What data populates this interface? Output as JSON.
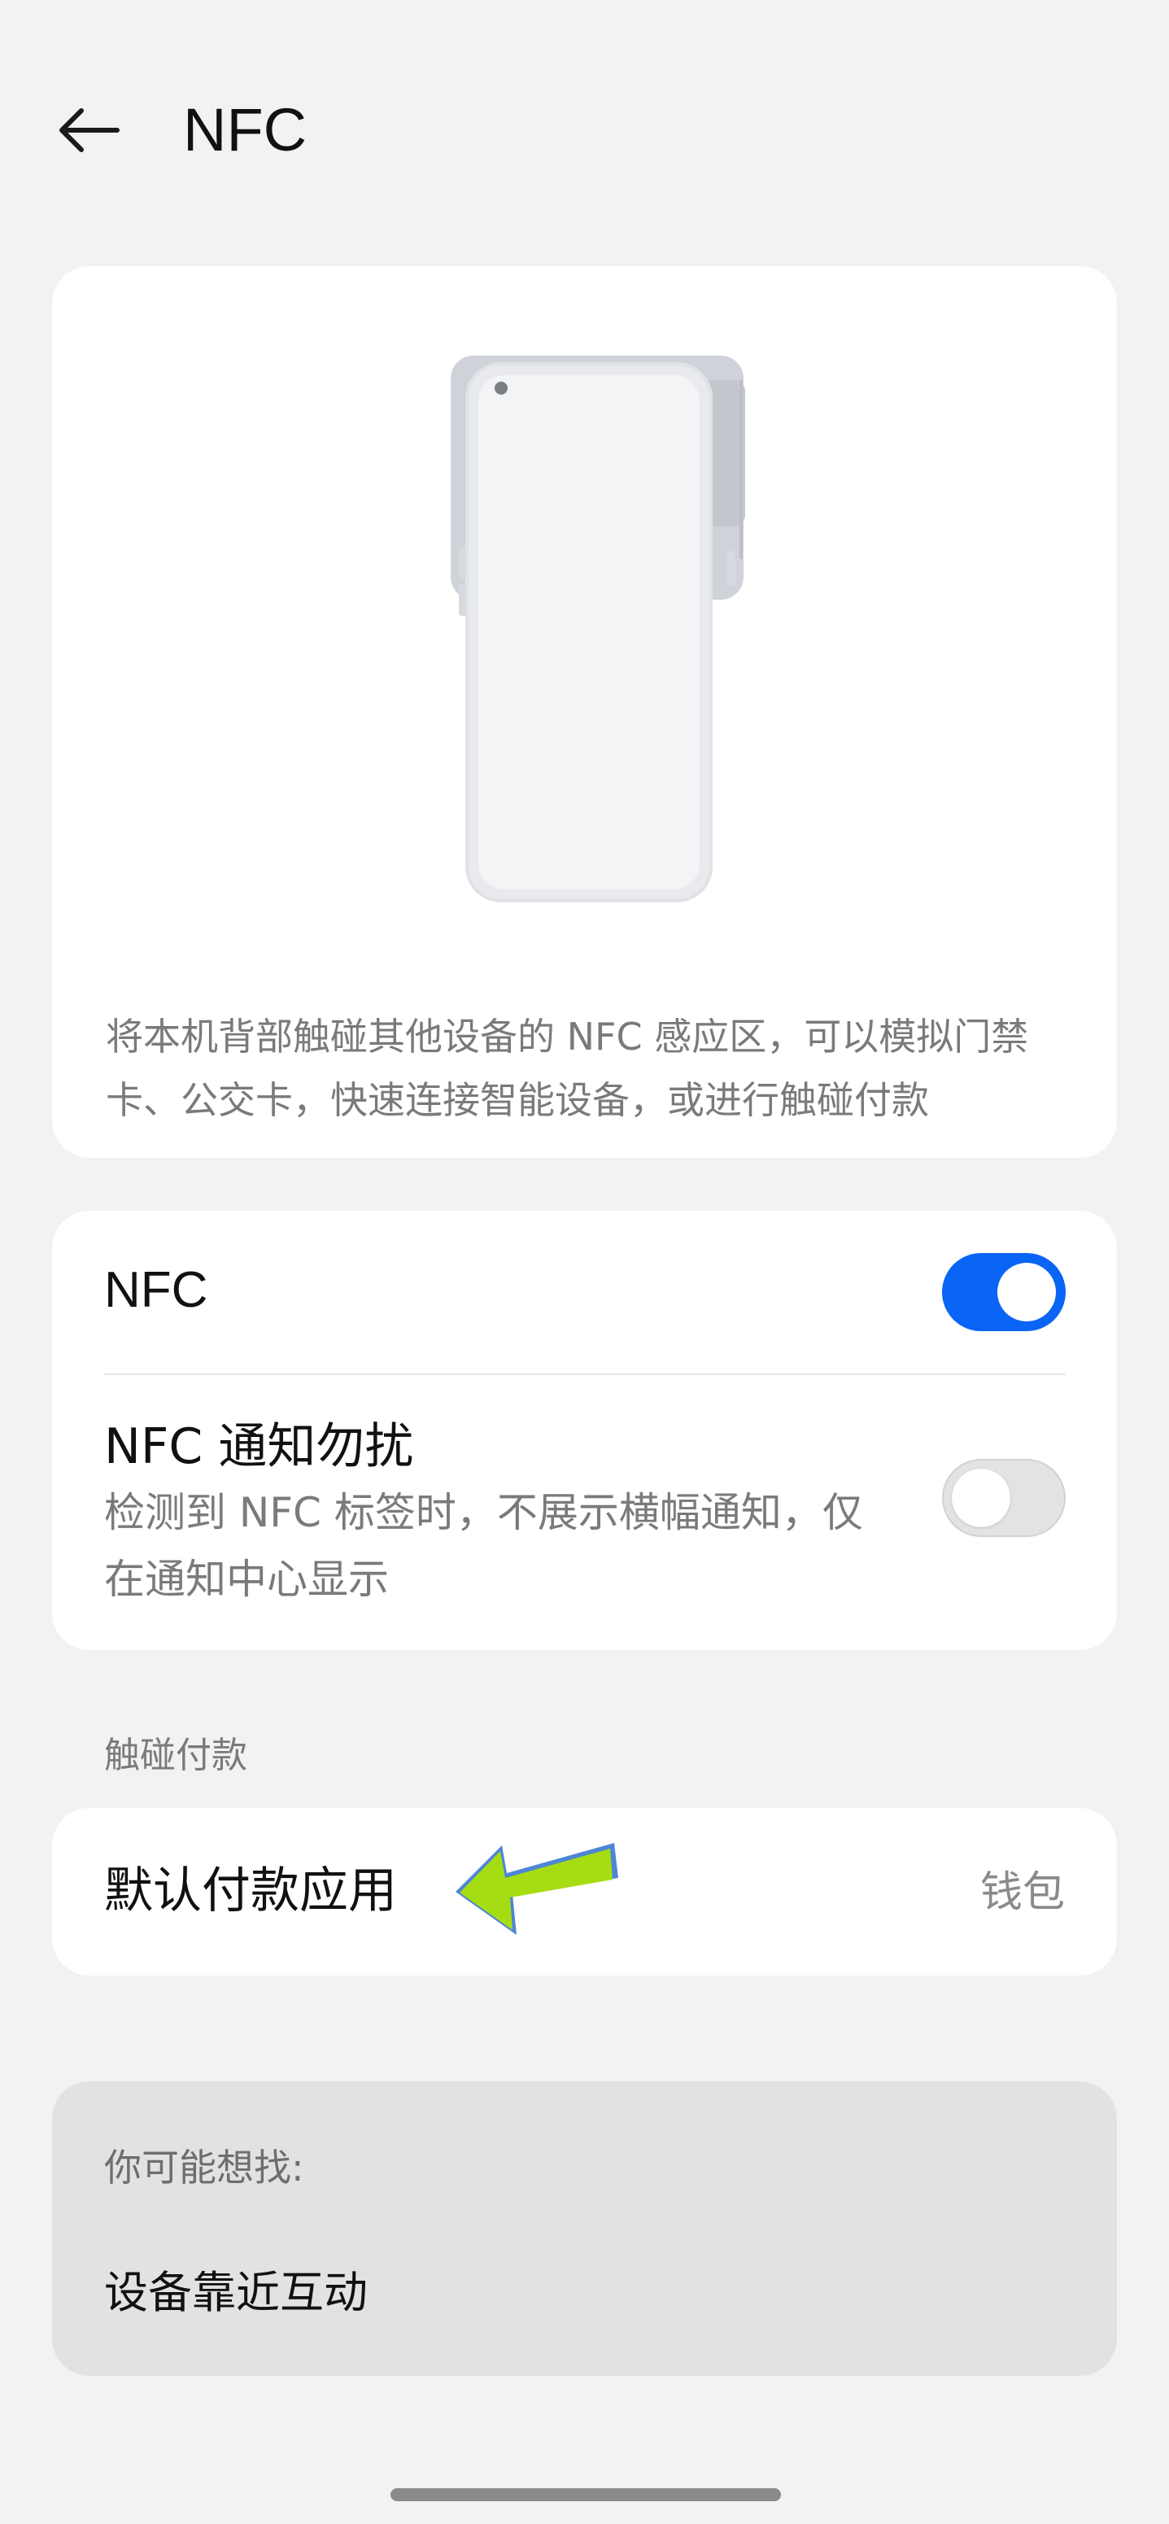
{
  "header": {
    "title": "NFC",
    "back_icon": "arrow-left-icon"
  },
  "hero": {
    "illustration": "phone-nfc-illustration",
    "description": "将本机背部触碰其他设备的 NFC 感应区，可以模拟门禁卡、公交卡，快速连接智能设备，或进行触碰付款"
  },
  "settings": {
    "nfc": {
      "label": "NFC",
      "enabled": true
    },
    "dnd": {
      "label": "NFC 通知勿扰",
      "description": "检测到 NFC 标签时，不展示横幅通知，仅在通知中心显示",
      "enabled": false
    }
  },
  "payment": {
    "section_title": "触碰付款",
    "label": "默认付款应用",
    "value": "钱包",
    "pointer": "green-arrow-icon"
  },
  "suggestions": {
    "title": "你可能想找:",
    "items": [
      "设备靠近互动"
    ]
  },
  "colors": {
    "background": "#f1f2f4",
    "card": "#ffffff",
    "accent": "#0a64f5",
    "arrow_green": "#a6dd12",
    "arrow_outline": "#4d86d6",
    "suggest_card": "#e1e2e4"
  }
}
